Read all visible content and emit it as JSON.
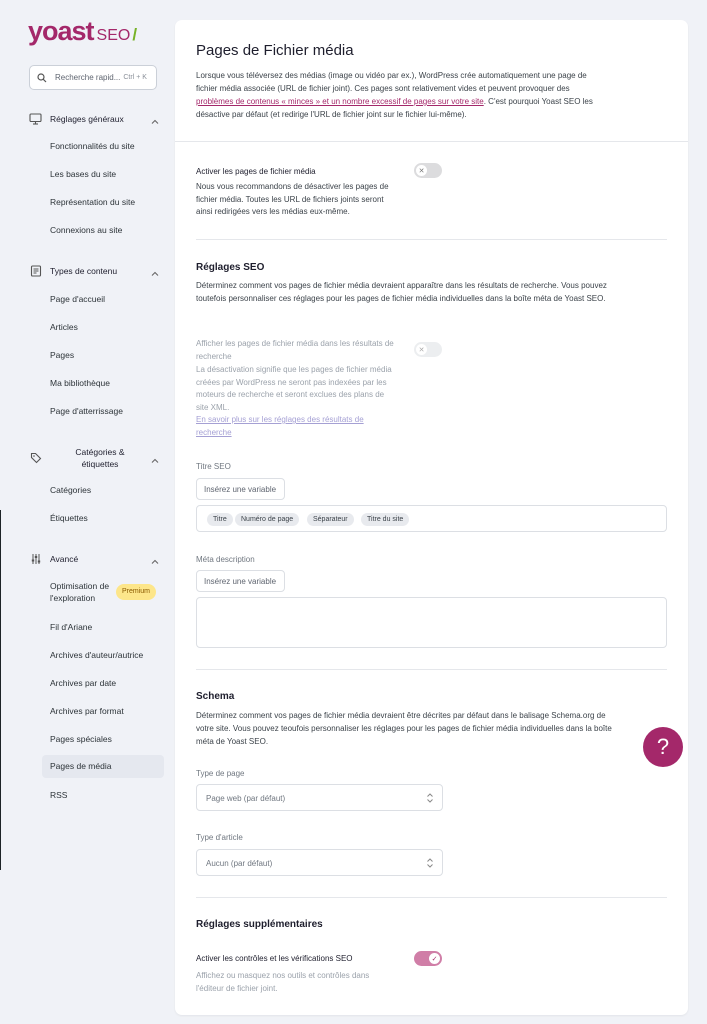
{
  "brand": {
    "name": "yoast",
    "suffix": "SEO",
    "slash": "/"
  },
  "search": {
    "placeholder": "Recherche rapid...",
    "shortcut": "Ctrl + K"
  },
  "sidebar": {
    "sections": [
      {
        "label": "Réglages généraux",
        "icon": "desktop-icon",
        "items": [
          "Fonctionnalités du site",
          "Les bases du site",
          "Représentation du site",
          "Connexions au site"
        ]
      },
      {
        "label": "Types de contenu",
        "icon": "document-icon",
        "items": [
          "Page d'accueil",
          "Articles",
          "Pages",
          "Ma bibliothèque",
          "Page d'atterrissage"
        ]
      },
      {
        "label": "Catégories & étiquettes",
        "icon": "tags-icon",
        "items": [
          "Catégories",
          "Étiquettes"
        ]
      },
      {
        "label": "Avancé",
        "icon": "sliders-icon",
        "items": [
          "Optimisation de l'exploration",
          "Fil d'Ariane",
          "Archives d'auteur/autrice",
          "Archives par date",
          "Archives par format",
          "Pages spéciales",
          "Pages de média",
          "RSS"
        ]
      }
    ],
    "premium_badge": "Premium",
    "active_item": "Pages de média"
  },
  "page": {
    "title": "Pages de Fichier média",
    "intro_before": "Lorsque vous téléversez des médias (image ou vidéo par ex.), WordPress crée automatiquement une page de fichier média associée (URL de fichier joint). Ces pages sont relativement vides et peuvent provoquer des ",
    "intro_link": "problèmes de contenus « minces » et un nombre excessif de pages sur votre site",
    "intro_after": ". C'est pourquoi Yoast SEO les désactive par défaut (et redirige l'URL de fichier joint sur le fichier lui-même).",
    "attachment_toggle": {
      "label": "Activer les pages de fichier média",
      "description": "Nous vous recommandons de désactiver les pages de fichier média. Toutes les URL de fichiers joints seront ainsi redirigées vers les médias eux-même.",
      "enabled": false
    },
    "seo": {
      "heading": "Réglages SEO",
      "description": "Déterminez comment vos pages de fichier média devraient apparaître dans les résultats de recherche. Vous pouvez toutefois personnaliser ces réglages pour les pages de fichier média individuelles dans la boîte méta de Yoast SEO.",
      "show_toggle": {
        "label": "Afficher les pages de fichier média dans les résultats de recherche",
        "description": "La désactivation signifie que les pages de fichier média créées par WordPress ne seront pas indexées par les moteurs de recherche et seront exclues des plans de site XML.",
        "link": "En savoir plus sur les réglages des résultats de recherche",
        "enabled": false
      },
      "title_label": "Titre SEO",
      "insert_variable": "Insérez une variable",
      "title_tags": [
        "Titre",
        "Numéro de page",
        "Séparateur",
        "Titre du site"
      ],
      "meta_label": "Méta description",
      "meta_value": ""
    },
    "schema": {
      "heading": "Schema",
      "description": "Déterminez comment vos pages de fichier média devraient être décrites par défaut dans le balisage Schema.org de votre site. Vous pouvez teoufois personnaliser les réglages pour les pages de fichier média individuelles dans la boîte méta de Yoast SEO.",
      "page_type_label": "Type de page",
      "page_type_value": "Page web (par défaut)",
      "article_type_label": "Type d'article",
      "article_type_value": "Aucun (par défaut)"
    },
    "extra": {
      "heading": "Réglages supplémentaires",
      "toggle_label": "Activer les contrôles et les vérifications SEO",
      "toggle_desc": "Affichez ou masquez nos outils et contrôles dans l'éditeur de fichier joint.",
      "enabled": true
    }
  },
  "help": {
    "label": "?"
  },
  "colors": {
    "brand": "#a4286a",
    "accent_green": "#77b227",
    "toggle_on": "#d07ea7",
    "premium": "#fde68a"
  }
}
